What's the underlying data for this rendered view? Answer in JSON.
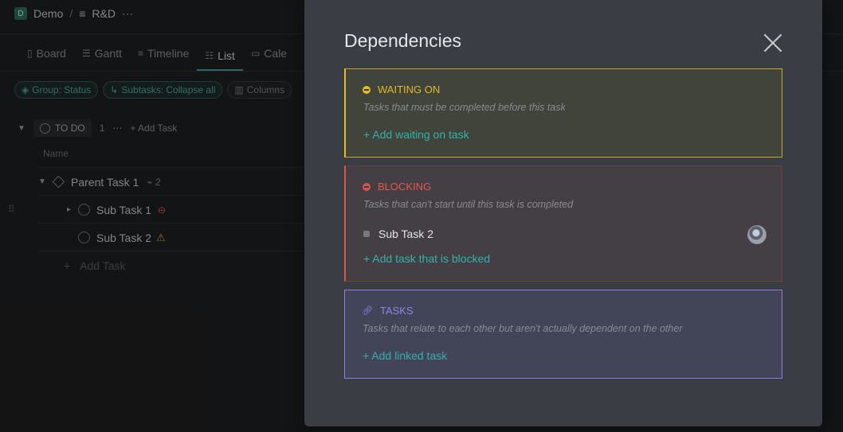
{
  "breadcrumb": {
    "workspace_initial": "D",
    "workspace": "Demo",
    "separator": "/",
    "list_icon": "list-icon",
    "list": "R&D",
    "more": "⋯"
  },
  "views": [
    {
      "label": "Board",
      "icon": "board-icon"
    },
    {
      "label": "Gantt",
      "icon": "gantt-icon"
    },
    {
      "label": "Timeline",
      "icon": "timeline-icon"
    },
    {
      "label": "List",
      "icon": "list-icon",
      "active": true
    },
    {
      "label": "Cale",
      "icon": "calendar-icon"
    }
  ],
  "toolbar": {
    "group": "Group: Status",
    "subtasks": "Subtasks: Collapse all",
    "columns": "Columns"
  },
  "group": {
    "status": "TO DO",
    "count": "1",
    "more": "⋯",
    "add_task": "+ Add Task"
  },
  "columns": {
    "name": "Name"
  },
  "tasks": [
    {
      "name": "Parent Task 1",
      "subtask_count": "2"
    },
    {
      "name": "Sub Task 1"
    },
    {
      "name": "Sub Task 2"
    }
  ],
  "add_task_row": "Add Task",
  "modal": {
    "title": "Dependencies",
    "waiting": {
      "title": "WAITING ON",
      "description": "Tasks that must be completed before this task",
      "add": "+ Add waiting on task",
      "color": "#e0bc27"
    },
    "blocking": {
      "title": "BLOCKING",
      "description": "Tasks that can't start until this task is completed",
      "item": "Sub Task 2",
      "add": "+ Add task that is blocked",
      "color": "#e2574f"
    },
    "linked": {
      "title": "TASKS",
      "description": "Tasks that relate to each other but aren't actually dependent on the other",
      "add": "+ Add linked task",
      "color": "#8f84ec"
    }
  }
}
